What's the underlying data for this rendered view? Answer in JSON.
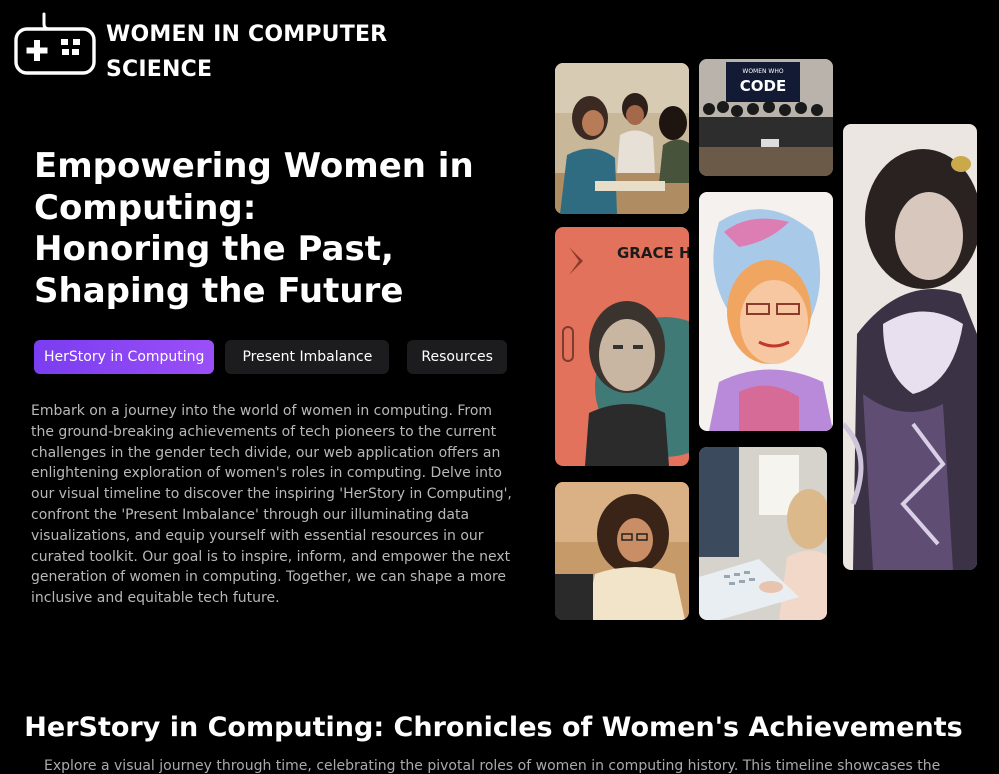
{
  "brand": {
    "line1": "WOMEN IN COMPUTER",
    "line2": "SCIENCE",
    "logo_icon": "gamepad-icon"
  },
  "hero": {
    "title_line1": "Empowering Women in",
    "title_line2": "Computing:",
    "title_line3": "Honoring the Past,",
    "title_line4": "Shaping the Future"
  },
  "tabs": [
    {
      "label": "HerStory in Computing",
      "active": true
    },
    {
      "label": "Present Imbalance",
      "active": false
    },
    {
      "label": "Resources",
      "active": false
    }
  ],
  "intro_text": "Embark on a journey into the world of women in computing. From the ground-breaking achievements of tech pioneers to the current challenges in the gender tech divide, our web application offers an enlightening exploration of women's roles in computing. Delve into our visual timeline to discover the inspiring 'HerStory in Computing', confront the 'Present Imbalance' through our illuminating data visualizations, and equip yourself with essential resources in our curated toolkit. Our goal is to inspire, inform, and empower the next generation of women in computing. Together, we can shape a more inclusive and equitable tech future.",
  "gallery": {
    "women_who_code_sign": "WOMEN WHO",
    "women_who_code_big": "CODE",
    "grace_label": "GRACE HO"
  },
  "section": {
    "title": "HerStory in Computing: Chronicles of Women's Achievements",
    "subtitle": "Explore a visual journey through time, celebrating the pivotal roles of women in computing history. This timeline showcases the"
  },
  "colors": {
    "background": "#000000",
    "accent_start": "#7a3df0",
    "accent_end": "#9b4ff7",
    "tab_bg": "#1c1c1e",
    "body_text": "#b8b8b8"
  }
}
